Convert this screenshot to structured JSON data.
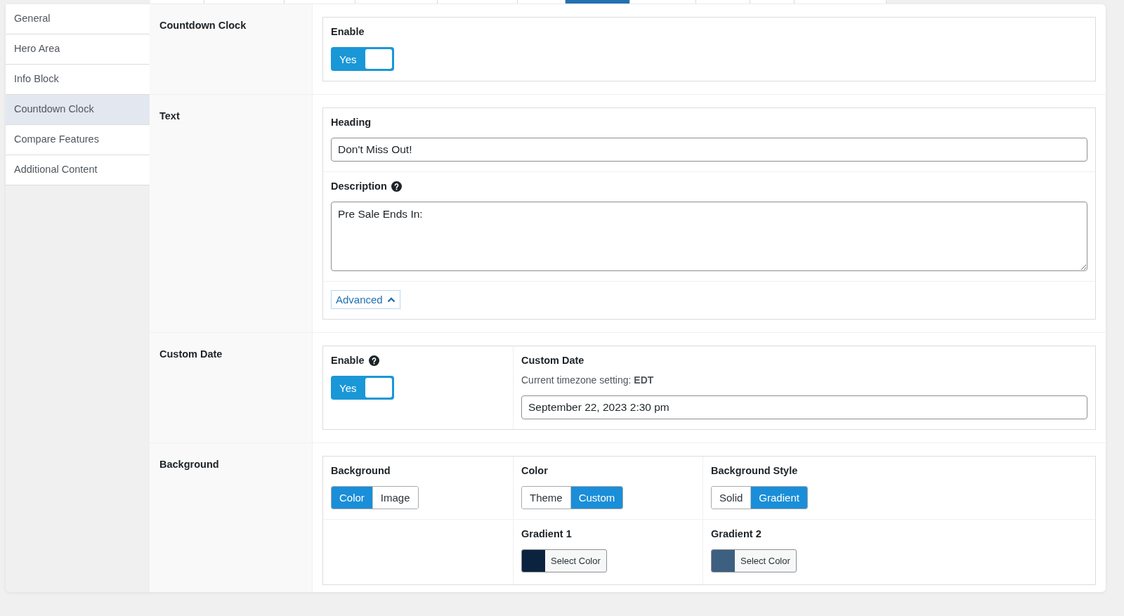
{
  "top_tabs": [
    {
      "selected": false
    },
    {
      "selected": false
    },
    {
      "selected": false
    },
    {
      "selected": false
    },
    {
      "selected": false
    },
    {
      "selected": false
    },
    {
      "selected": true
    },
    {
      "selected": false
    },
    {
      "selected": false
    },
    {
      "selected": false
    },
    {
      "selected": false
    }
  ],
  "sidebar": {
    "items": [
      {
        "label": "General",
        "selected": false
      },
      {
        "label": "Hero Area",
        "selected": false
      },
      {
        "label": "Info Block",
        "selected": false
      },
      {
        "label": "Countdown Clock",
        "selected": true
      },
      {
        "label": "Compare Features",
        "selected": false
      },
      {
        "label": "Additional Content",
        "selected": false
      }
    ]
  },
  "sections": [
    {
      "label": "Countdown Clock",
      "rows": [
        [
          {
            "kind": "toggle",
            "label": "Enable",
            "help": false,
            "value": "Yes",
            "on": true
          }
        ]
      ]
    },
    {
      "label": "Text",
      "rows": [
        [
          {
            "kind": "text",
            "label": "Heading",
            "help": false,
            "value": "Don't Miss Out!"
          }
        ],
        [
          {
            "kind": "textarea",
            "label": "Description",
            "help": true,
            "value": "Pre Sale Ends In:"
          }
        ],
        [
          {
            "kind": "link",
            "text": "Advanced",
            "expanded": true
          }
        ]
      ]
    },
    {
      "label": "Custom Date",
      "rows": [
        [
          {
            "kind": "toggle",
            "label": "Enable",
            "help": true,
            "value": "Yes",
            "on": true
          },
          {
            "kind": "date",
            "label": "Custom Date",
            "help": false,
            "note": "Current timezone setting: **EDT**",
            "value": "September 22, 2023 2:30 pm"
          }
        ]
      ]
    },
    {
      "label": "Background",
      "rows": [
        [
          {
            "kind": "segmented",
            "label": "Background",
            "help": false,
            "options": [
              {
                "text": "Color",
                "selected": true
              },
              {
                "text": "Image",
                "selected": false
              }
            ]
          },
          {
            "kind": "segmented",
            "label": "Color",
            "help": false,
            "options": [
              {
                "text": "Theme",
                "selected": false
              },
              {
                "text": "Custom",
                "selected": true
              }
            ]
          },
          {
            "kind": "segmented",
            "label": "Background Style",
            "help": false,
            "options": [
              {
                "text": "Solid",
                "selected": false
              },
              {
                "text": "Gradient",
                "selected": true
              }
            ]
          }
        ],
        [
          {
            "kind": "empty"
          },
          {
            "kind": "color",
            "label": "Gradient 1",
            "help": false,
            "button": "Select Color",
            "color": "#0c2340"
          },
          {
            "kind": "color",
            "label": "Gradient 2",
            "help": false,
            "button": "Select Color",
            "color": "#3d5f80"
          }
        ]
      ]
    }
  ]
}
